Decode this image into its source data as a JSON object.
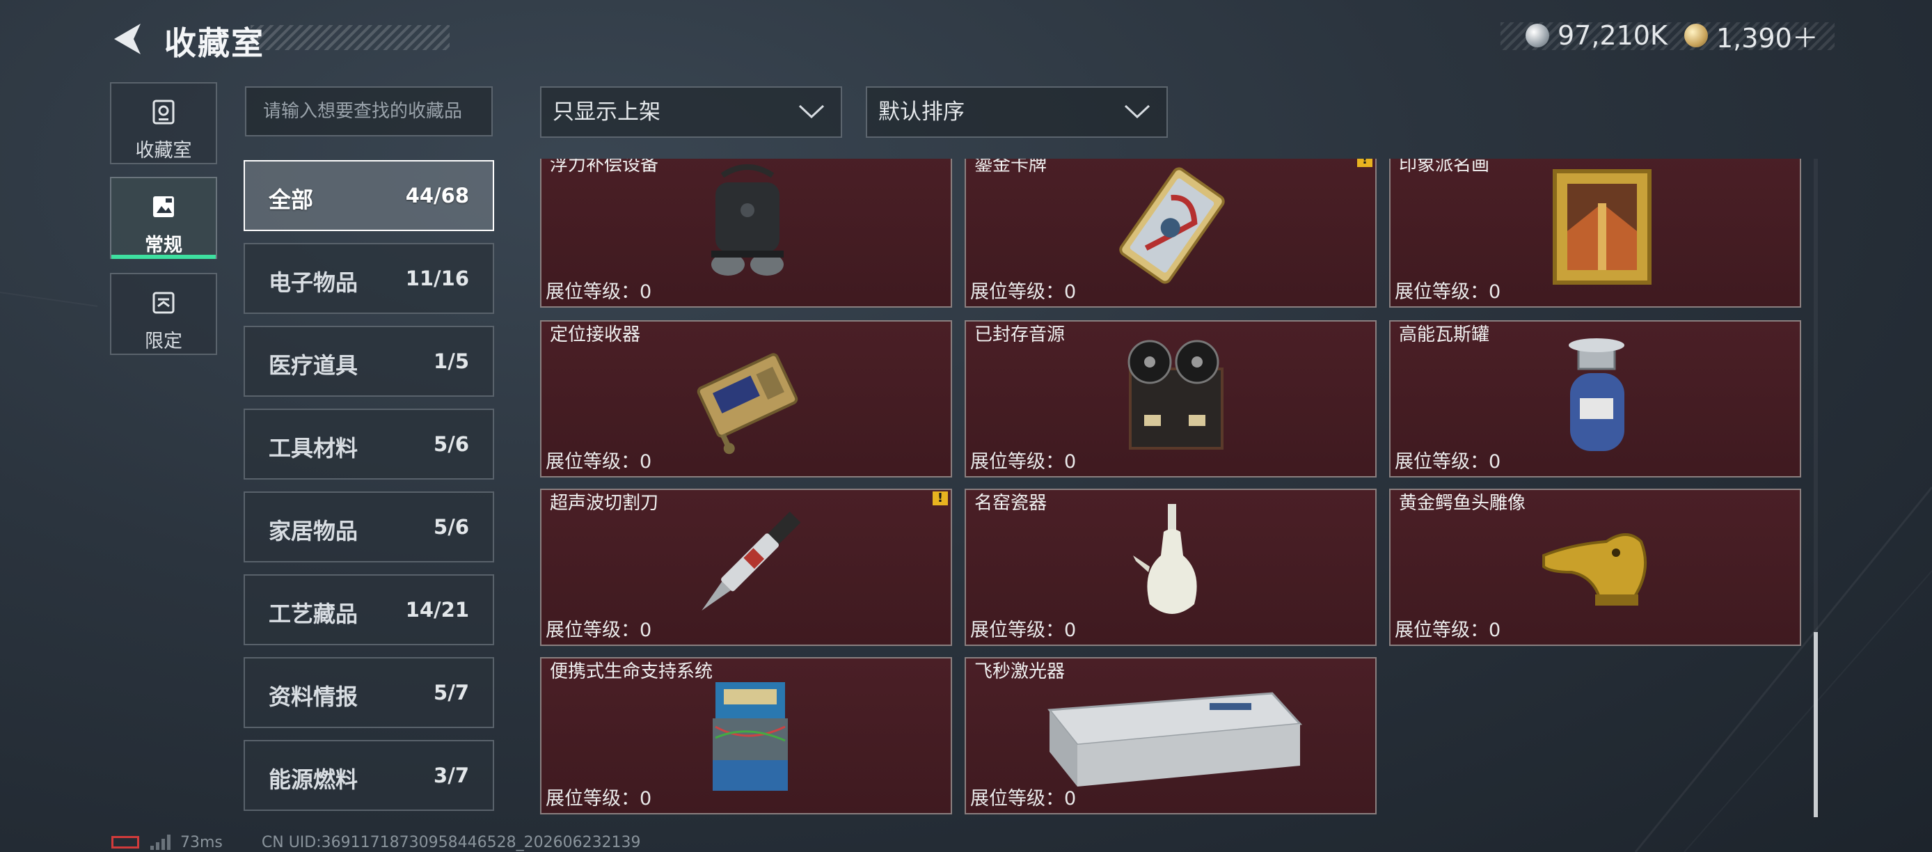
{
  "header": {
    "title": "收藏室",
    "currency": [
      {
        "icon": "silver-coin-icon",
        "value": "97,210K"
      },
      {
        "icon": "gold-coin-icon",
        "value": "1,390＋"
      }
    ]
  },
  "side_tabs": [
    {
      "label": "收藏室",
      "icon": "collection-icon",
      "active": false
    },
    {
      "label": "常规",
      "icon": "regular-icon",
      "active": true
    },
    {
      "label": "限定",
      "icon": "limited-icon",
      "active": false
    }
  ],
  "search": {
    "placeholder": "请输入想要查找的收藏品"
  },
  "filters": {
    "shelf_filter": "只显示上架",
    "sort": "默认排序"
  },
  "categories": [
    {
      "name": "全部",
      "count": "44/68",
      "active": true
    },
    {
      "name": "电子物品",
      "count": "11/16"
    },
    {
      "name": "医疗道具",
      "count": "1/5"
    },
    {
      "name": "工具材料",
      "count": "5/6"
    },
    {
      "name": "家居物品",
      "count": "5/6"
    },
    {
      "name": "工艺藏品",
      "count": "14/21"
    },
    {
      "name": "资料情报",
      "count": "5/7"
    },
    {
      "name": "能源燃料",
      "count": "3/7"
    }
  ],
  "level_label": "展位等级：0",
  "items": [
    {
      "name": "浮力补偿设备",
      "icon": "bcd-backpack-icon",
      "warning": false
    },
    {
      "name": "鎏金卡牌",
      "icon": "gilded-card-icon",
      "warning": true
    },
    {
      "name": "印象派名画",
      "icon": "painting-icon",
      "warning": false
    },
    {
      "name": "定位接收器",
      "icon": "locator-receiver-icon",
      "warning": false
    },
    {
      "name": "已封存音源",
      "icon": "reel-recorder-icon",
      "warning": false
    },
    {
      "name": "高能瓦斯罐",
      "icon": "gas-canister-icon",
      "warning": false
    },
    {
      "name": "超声波切割刀",
      "icon": "ultrasonic-knife-icon",
      "warning": true
    },
    {
      "name": "名窑瓷器",
      "icon": "porcelain-vase-icon",
      "warning": false
    },
    {
      "name": "黄金鳄鱼头雕像",
      "icon": "gold-crocodile-icon",
      "warning": false
    },
    {
      "name": "便携式生命支持系统",
      "icon": "life-support-icon",
      "warning": false
    },
    {
      "name": "飞秒激光器",
      "icon": "laser-device-icon",
      "warning": false
    }
  ],
  "warning_mark": "!",
  "footer": {
    "ping": "73ms",
    "uid": "CN UID:369117187309584465​28_202606232139"
  }
}
